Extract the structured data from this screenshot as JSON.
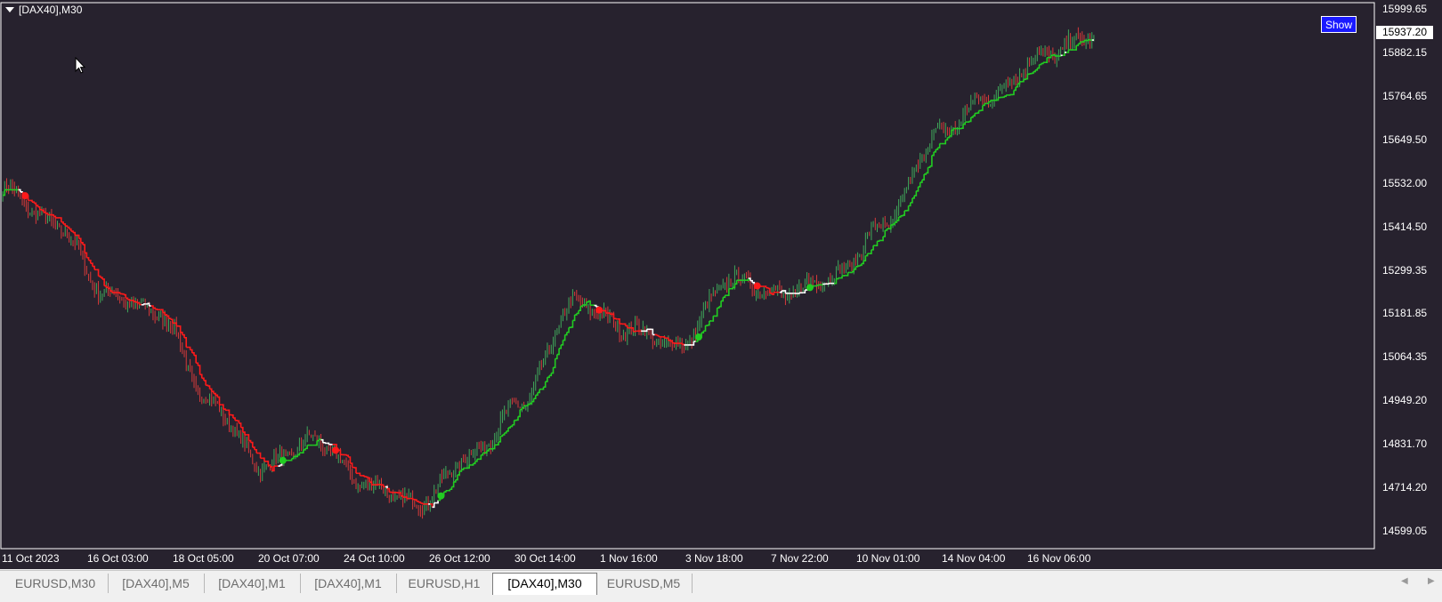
{
  "window": {
    "title": "[DAX40],M30",
    "show_button": "Show",
    "background": "#27222e",
    "colors": {
      "bull_candle": "#3fa85a",
      "bear_candle": "#d63a3a",
      "trend_up": "#22cc22",
      "trend_down": "#ff1a1a",
      "trend_neutral": "#ffffff"
    }
  },
  "price_axis": {
    "labels": [
      "15999.65",
      "15882.15",
      "15764.65",
      "15649.50",
      "15532.00",
      "15414.50",
      "15299.35",
      "15181.85",
      "15064.35",
      "14949.20",
      "14831.70",
      "14714.20",
      "14599.05"
    ],
    "current_price": "15937.20"
  },
  "time_axis": {
    "labels": [
      "11 Oct 2023",
      "16 Oct 03:00",
      "18 Oct 05:00",
      "20 Oct 07:00",
      "24 Oct 10:00",
      "26 Oct 12:00",
      "30 Oct 14:00",
      "1 Nov 16:00",
      "3 Nov 18:00",
      "7 Nov 22:00",
      "10 Nov 01:00",
      "14 Nov 04:00",
      "16 Nov 06:00"
    ]
  },
  "tabs": [
    {
      "label": "EURUSD,M30",
      "active": false
    },
    {
      "label": "[DAX40],M5",
      "active": false
    },
    {
      "label": "[DAX40],M1",
      "active": false
    },
    {
      "label": "[DAX40],M1",
      "active": false
    },
    {
      "label": "EURUSD,H1",
      "active": false
    },
    {
      "label": "[DAX40],M30",
      "active": true
    },
    {
      "label": "EURUSD,M5",
      "active": false
    }
  ],
  "tab_nav": {
    "left_icon": "chevron-left-icon",
    "right_icon": "chevron-right-icon"
  },
  "chart_data": {
    "type": "line",
    "title": "[DAX40],M30",
    "ylim": [
      14570,
      16030
    ],
    "x": [
      "11 Oct 2023",
      "16 Oct 03:00",
      "18 Oct 05:00",
      "20 Oct 07:00",
      "24 Oct 10:00",
      "26 Oct 12:00",
      "30 Oct 14:00",
      "1 Nov 16:00",
      "3 Nov 18:00",
      "7 Nov 22:00",
      "10 Nov 01:00",
      "14 Nov 04:00",
      "16 Nov 06:00"
    ],
    "series": [
      {
        "values": [
          15530,
          15440,
          15250,
          15200,
          14960,
          14790,
          14860,
          14740,
          14690,
          14820,
          14960,
          15230,
          15160,
          15110,
          15290,
          15250,
          15300,
          15440,
          15680,
          15780,
          15890,
          15940
        ]
      }
    ]
  }
}
